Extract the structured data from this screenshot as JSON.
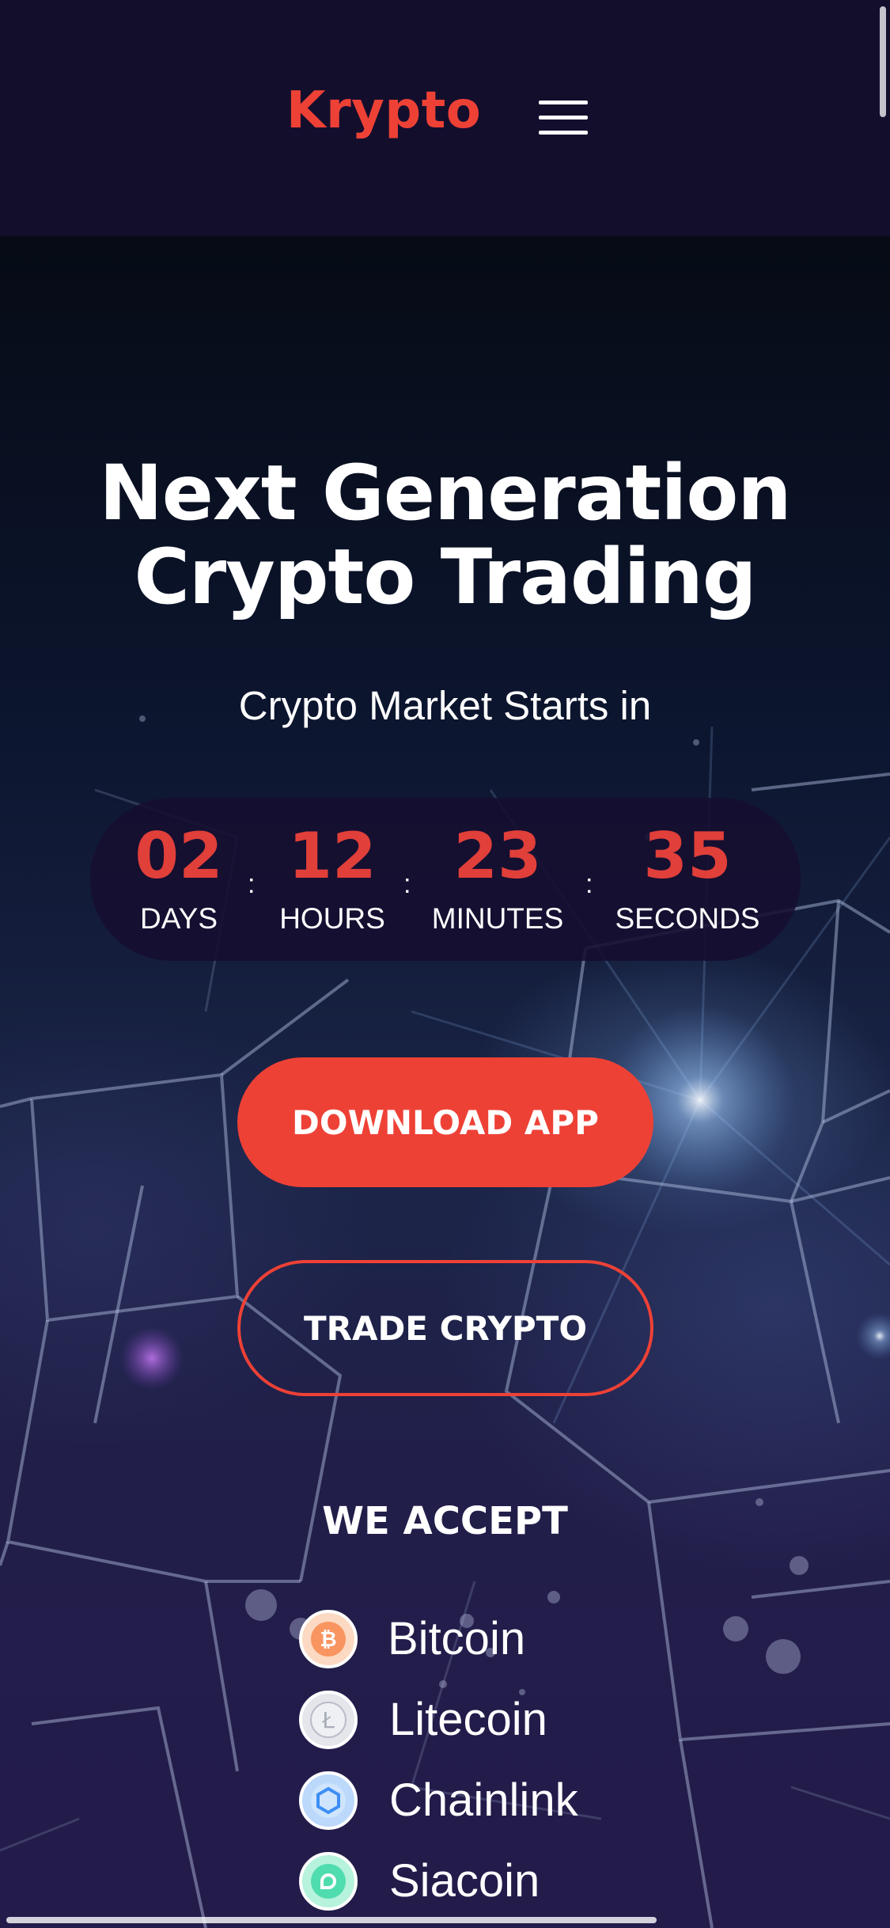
{
  "header": {
    "brand": "Krypto",
    "menu_icon": "hamburger-menu-icon"
  },
  "hero": {
    "headline_line1": "Next Generation",
    "headline_line2": "Crypto Trading",
    "subtitle": "Crypto Market Starts in"
  },
  "countdown": {
    "separator": ":",
    "units": [
      {
        "value": "02",
        "label": "DAYS"
      },
      {
        "value": "12",
        "label": "HOURS"
      },
      {
        "value": "23",
        "label": "MINUTES"
      },
      {
        "value": "35",
        "label": "SECONDS"
      }
    ]
  },
  "actions": {
    "download_label": "DOWNLOAD APP",
    "trade_label": "TRADE CRYPTO"
  },
  "accept": {
    "title": "WE ACCEPT",
    "coins": [
      {
        "name": "Bitcoin",
        "icon": "bitcoin-icon",
        "color": "#f7931a",
        "glyph": "₿"
      },
      {
        "name": "Litecoin",
        "icon": "litecoin-icon",
        "color": "#a6a9aa",
        "glyph": "Ł"
      },
      {
        "name": "Chainlink",
        "icon": "chainlink-icon",
        "color": "#2a5ada",
        "glyph": ""
      },
      {
        "name": "Siacoin",
        "icon": "siacoin-icon",
        "color": "#20ee82",
        "glyph": ""
      }
    ]
  },
  "colors": {
    "accent": "#ee4136",
    "header_bg": "#140e2d",
    "countdown_number": "#e03f3a"
  }
}
